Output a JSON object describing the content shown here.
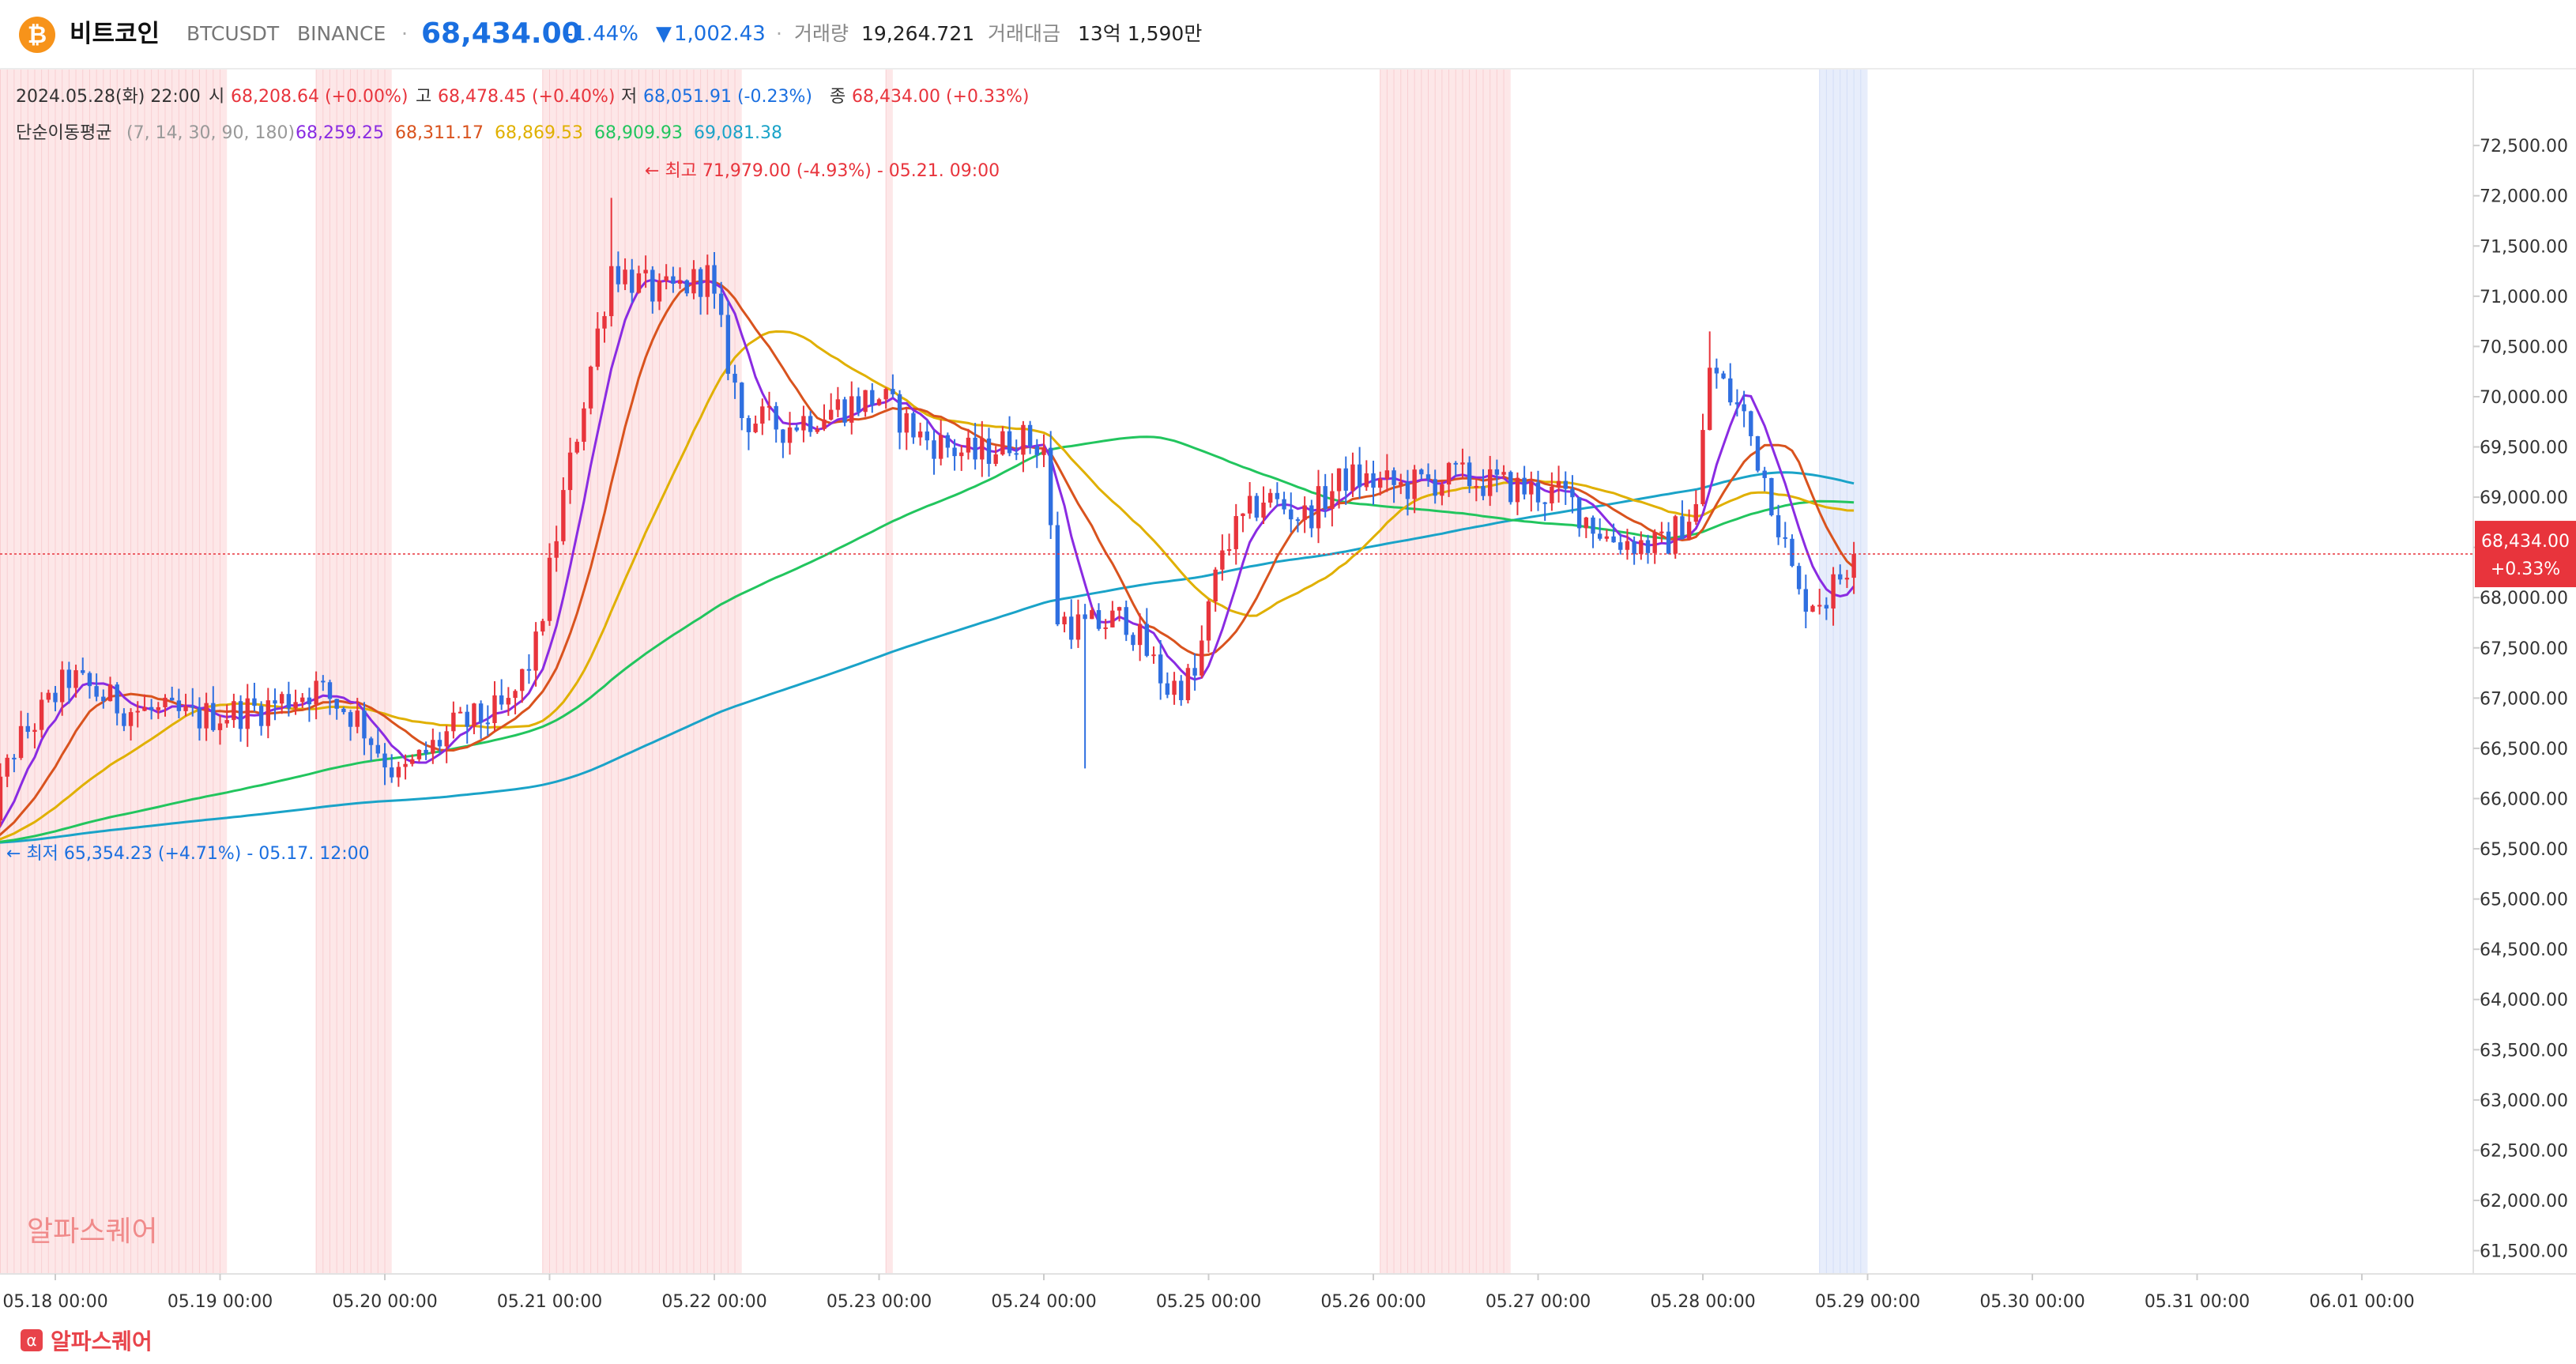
{
  "header": {
    "coin_icon": "bitcoin-icon",
    "coin_name": "비트코인",
    "symbol": "BTCUSDT",
    "exchange": "BINANCE",
    "price": "68,434.00",
    "change_pct": "-1.44%",
    "change_abs": "1,002.43",
    "volume_label": "거래량",
    "volume_value": "19,264.721",
    "amount_label": "거래대금",
    "amount_value": "13억 1,590만"
  },
  "ohlc": {
    "datetime": "2024.05.28(화) 22:00",
    "open_label": "시",
    "open_value": "68,208.64 (+0.00%)",
    "high_label": "고",
    "high_value": "68,478.45 (+0.40%)",
    "low_label": "저",
    "low_value": "68,051.91 (-0.23%)",
    "close_label": "종",
    "close_value": "68,434.00 (+0.33%)"
  },
  "ma_legend": {
    "label": "단순이동평균",
    "periods": "(7, 14, 30, 90, 180)",
    "values": [
      "68,259.25",
      "68,311.17",
      "68,869.53",
      "68,909.93",
      "69,081.38"
    ]
  },
  "annotations": {
    "high": "최고 71,979.00 (-4.93%) - 05.21. 09:00",
    "low": "최저 65,354.23 (+4.71%) - 05.17. 12:00"
  },
  "price_tag": {
    "price": "68,434.00",
    "pct": "+0.33%"
  },
  "watermark": "알파스퀘어",
  "footer_logo": "알파스퀘어",
  "colors": {
    "up": "#e8343c",
    "down": "#2f6fe0",
    "ma7": "#8a2be2",
    "ma14": "#d9531e",
    "ma30": "#e0b000",
    "ma90": "#22c55e",
    "ma180": "#1aa3c8",
    "price_blue": "#1a6fe0",
    "price_tag_bg": "#e8343c"
  },
  "chart_data": {
    "type": "candlestick",
    "interval": "1h",
    "x_start": "2024-05-17 13:00",
    "x_end": "2024-05-28 22:00",
    "ylim": [
      61300,
      72800
    ],
    "y_ticks": [
      "72,500.00",
      "72,000.00",
      "71,500.00",
      "71,000.00",
      "70,500.00",
      "70,000.00",
      "69,500.00",
      "69,000.00",
      "68,500.00",
      "68,000.00",
      "67,500.00",
      "67,000.00",
      "66,500.00",
      "66,000.00",
      "65,500.00",
      "65,000.00",
      "64,500.00",
      "64,000.00",
      "63,500.00",
      "63,000.00",
      "62,500.00",
      "62,000.00",
      "61,500.00"
    ],
    "y_tick_values": [
      72500,
      72000,
      71500,
      71000,
      70500,
      70000,
      69500,
      69000,
      68500,
      68000,
      67500,
      67000,
      66500,
      66000,
      65500,
      65000,
      64500,
      64000,
      63500,
      63000,
      62500,
      62000,
      61500
    ],
    "x_ticks": [
      "05.18 00:00",
      "05.19 00:00",
      "05.20 00:00",
      "05.21 00:00",
      "05.22 00:00",
      "05.23 00:00",
      "05.24 00:00",
      "05.25 00:00",
      "05.26 00:00",
      "05.27 00:00",
      "05.28 00:00",
      "05.29 00:00",
      "05.30 00:00",
      "05.31 00:00",
      "06.01 00:00"
    ],
    "last_close": 68434,
    "price_anchors": [
      [
        "2024-05-17 13:00",
        65500
      ],
      [
        "2024-05-17 18:00",
        66500
      ],
      [
        "2024-05-18 02:00",
        67200
      ],
      [
        "2024-05-18 10:00",
        66900
      ],
      [
        "2024-05-18 20:00",
        66800
      ],
      [
        "2024-05-19 06:00",
        66900
      ],
      [
        "2024-05-19 14:00",
        67100
      ],
      [
        "2024-05-19 20:00",
        66800
      ],
      [
        "2024-05-20 02:00",
        66200
      ],
      [
        "2024-05-20 10:00",
        66700
      ],
      [
        "2024-05-20 18:00",
        66900
      ],
      [
        "2024-05-20 22:00",
        67500
      ],
      [
        "2024-05-21 02:00",
        69000
      ],
      [
        "2024-05-21 06:00",
        70300
      ],
      [
        "2024-05-21 09:00",
        71300
      ],
      [
        "2024-05-21 16:00",
        71000
      ],
      [
        "2024-05-21 23:00",
        71200
      ],
      [
        "2024-05-22 04:00",
        69800
      ],
      [
        "2024-05-22 10:00",
        69700
      ],
      [
        "2024-05-22 18:00",
        69900
      ],
      [
        "2024-05-23 00:00",
        70000
      ],
      [
        "2024-05-23 06:00",
        69600
      ],
      [
        "2024-05-23 14:00",
        69400
      ],
      [
        "2024-05-23 20:00",
        69600
      ],
      [
        "2024-05-24 00:00",
        69500
      ],
      [
        "2024-05-24 02:00",
        67800
      ],
      [
        "2024-05-24 06:00",
        67700
      ],
      [
        "2024-05-24 12:00",
        67800
      ],
      [
        "2024-05-24 18:00",
        67100
      ],
      [
        "2024-05-24 22:00",
        67200
      ],
      [
        "2024-05-25 02:00",
        68500
      ],
      [
        "2024-05-25 08:00",
        69000
      ],
      [
        "2024-05-25 14:00",
        68800
      ],
      [
        "2024-05-25 20:00",
        69200
      ],
      [
        "2024-05-26 04:00",
        69100
      ],
      [
        "2024-05-26 12:00",
        69200
      ],
      [
        "2024-05-26 20:00",
        69100
      ],
      [
        "2024-05-27 04:00",
        69000
      ],
      [
        "2024-05-27 10:00",
        68600
      ],
      [
        "2024-05-27 18:00",
        68500
      ],
      [
        "2024-05-27 23:00",
        68900
      ],
      [
        "2024-05-28 01:00",
        70300
      ],
      [
        "2024-05-28 06:00",
        69800
      ],
      [
        "2024-05-28 10:00",
        69000
      ],
      [
        "2024-05-28 14:00",
        68000
      ],
      [
        "2024-05-28 18:00",
        68000
      ],
      [
        "2024-05-28 22:00",
        68434
      ]
    ],
    "wick_events": [
      [
        "2024-05-21 09:00",
        71979,
        "high"
      ],
      [
        "2024-05-17 13:00",
        65354,
        "low"
      ],
      [
        "2024-05-24 06:00",
        66300,
        "low"
      ],
      [
        "2024-05-28 01:00",
        70650,
        "high"
      ]
    ],
    "moving_averages": [
      {
        "name": "SMA 7",
        "value": 68259.25
      },
      {
        "name": "SMA 14",
        "value": 68311.17
      },
      {
        "name": "SMA 30",
        "value": 68869.53
      },
      {
        "name": "SMA 90",
        "value": 68909.93
      },
      {
        "name": "SMA 180",
        "value": 69081.38
      }
    ],
    "shaded_ranges_red": [
      [
        "2024-05-17 14:00",
        "2024-05-19 01:00"
      ],
      [
        "2024-05-19 14:00",
        "2024-05-20 01:00"
      ],
      [
        "2024-05-20 23:00",
        "2024-05-22 04:00"
      ],
      [
        "2024-05-23 01:00",
        "2024-05-23 02:00"
      ],
      [
        "2024-05-26 01:00",
        "2024-05-26 20:00"
      ]
    ],
    "shaded_ranges_blue": [
      [
        "2024-05-28 17:00",
        "2024-05-29 00:00"
      ]
    ],
    "grid": false
  }
}
